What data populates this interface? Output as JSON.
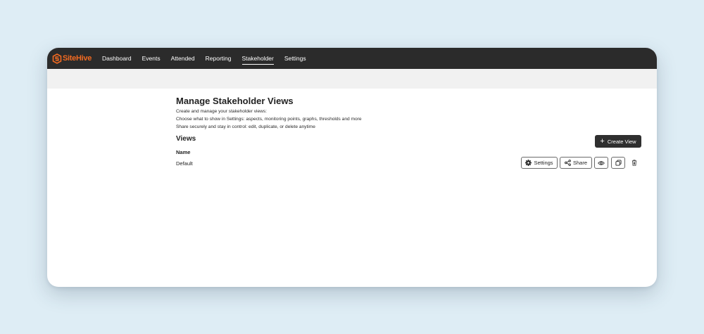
{
  "app": {
    "brand": "SiteHive",
    "brand_color": "#f26a21"
  },
  "nav": {
    "items": [
      {
        "label": "Dashboard",
        "active": false
      },
      {
        "label": "Events",
        "active": false
      },
      {
        "label": "Attended",
        "active": false
      },
      {
        "label": "Reporting",
        "active": false
      },
      {
        "label": "Stakeholder",
        "active": true
      },
      {
        "label": "Settings",
        "active": false
      }
    ]
  },
  "page": {
    "title": "Manage Stakeholder Views",
    "descriptions": [
      "Create and manage your stakeholder views:",
      "Choose what to show in Settings: aspects, monitoring points, graphs, thresholds and more",
      "Share securely and stay in control: edit, duplicate, or delete anytime"
    ]
  },
  "views": {
    "heading": "Views",
    "create_label": "Create View",
    "column_header": "Name",
    "rows": [
      {
        "name": "Default"
      }
    ]
  },
  "row_actions": {
    "settings_label": "Settings",
    "share_label": "Share",
    "icons": {
      "settings": "gear-icon",
      "share": "share-icon",
      "view": "eye-icon",
      "duplicate": "duplicate-icon",
      "delete": "trash-icon"
    }
  }
}
